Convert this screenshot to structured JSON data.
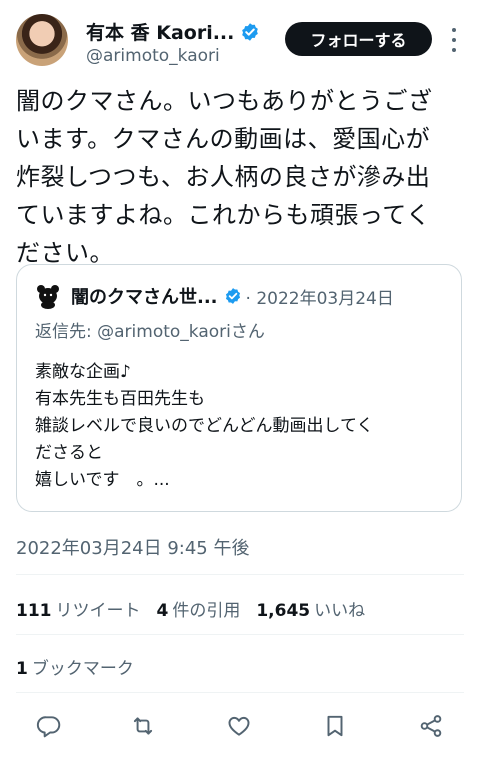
{
  "author": {
    "name": "有本 香 Kaori...",
    "handle": "@arimoto_kaori",
    "follow_label": "フォローする"
  },
  "tweet": {
    "lines": [
      "闇のクマさん。いつもありがとうござ",
      "います。クマさんの動画は、愛国心が",
      "炸裂しつつも、お人柄の良さが滲み出",
      "ていますよね。これからも頑張ってく",
      "ださい。"
    ],
    "timestamp": "2022年03月24日 9:45 午後"
  },
  "quote": {
    "name": "闇のクマさん世...",
    "date": "· 2022年03月24日",
    "reply_to": "返信先: @arimoto_kaoriさん",
    "lines": [
      "素敵な企画♪",
      "有本先生も百田先生も",
      "雑談レベルで良いのでどんどん動画出してく",
      "ださると",
      "嬉しいです　。..."
    ]
  },
  "stats": {
    "retweets_count": "111",
    "retweets_label": "リツイート",
    "quotes_count": "4",
    "quotes_label": "件の引用",
    "likes_count": "1,645",
    "likes_label": "いいね",
    "bookmarks_count": "1",
    "bookmarks_label": "ブックマーク"
  },
  "actions": [
    "reply-icon",
    "retweet-icon",
    "like-icon",
    "bookmark-icon",
    "share-icon"
  ],
  "colors": {
    "text": "#0f1419",
    "secondary": "#536471",
    "verified": "#1d9bf0",
    "border": "#cfd9de"
  }
}
